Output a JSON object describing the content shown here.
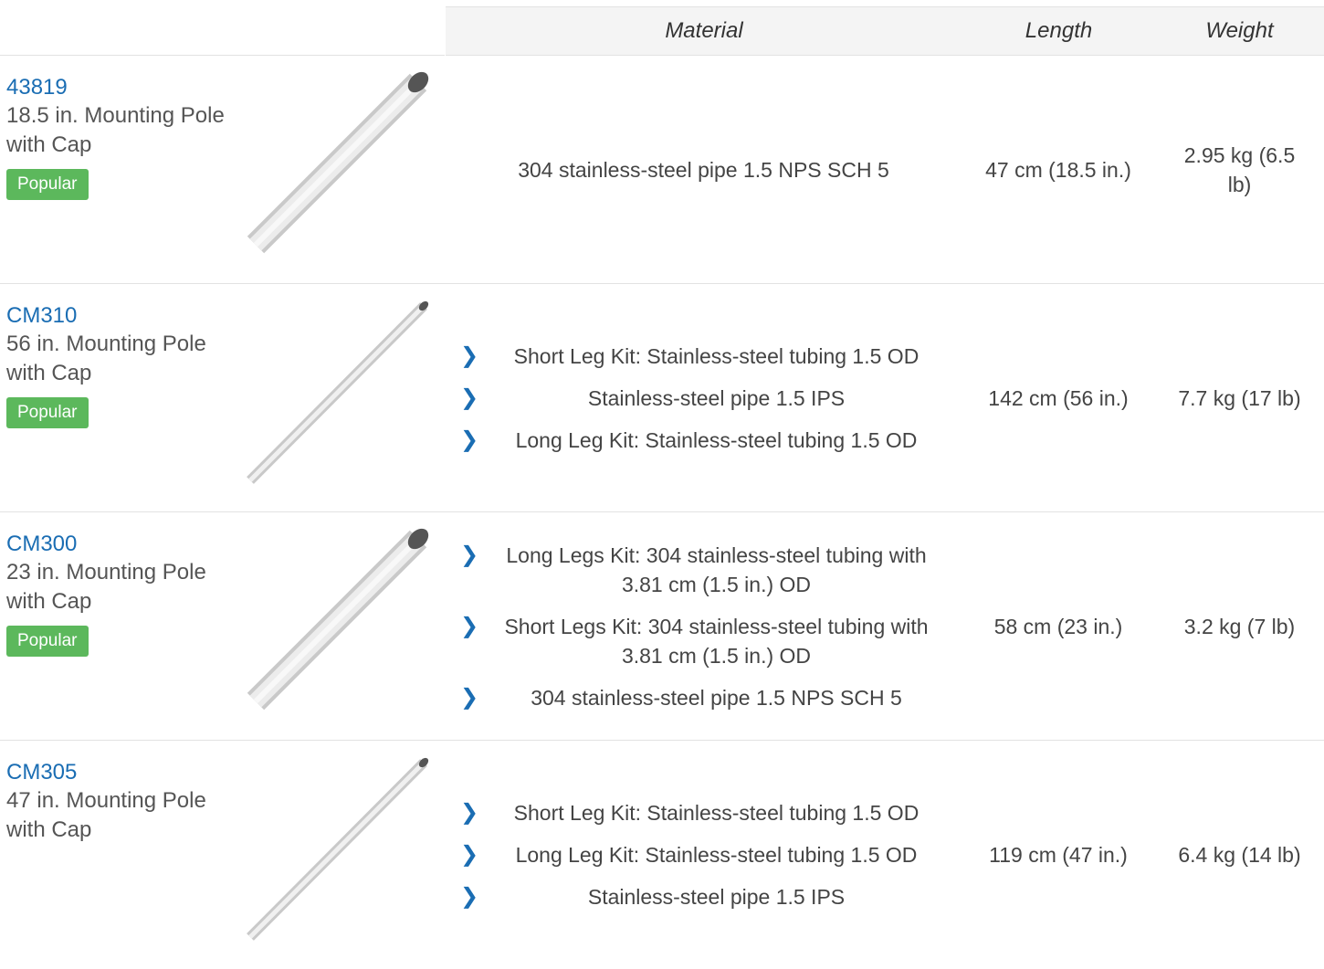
{
  "headers": {
    "material": "Material",
    "length": "Length",
    "weight": "Weight"
  },
  "rows": [
    {
      "code": "43819",
      "title": "18.5 in. Mounting Pole with Cap",
      "badge": "Popular",
      "materials": [
        "304 stainless-steel pipe 1.5 NPS SCH 5"
      ],
      "length": "47 cm (18.5 in.)",
      "weight": "2.95 kg (6.5 lb)"
    },
    {
      "code": "CM310",
      "title": "56 in. Mounting Pole with Cap",
      "badge": "Popular",
      "materials": [
        "Short Leg Kit: Stainless-steel tubing 1.5 OD",
        "Stainless-steel pipe 1.5 IPS",
        "Long Leg Kit: Stainless-steel tubing 1.5 OD"
      ],
      "length": "142 cm (56 in.)",
      "weight": "7.7 kg (17 lb)"
    },
    {
      "code": "CM300",
      "title": "23 in. Mounting Pole with Cap",
      "badge": "Popular",
      "materials": [
        "Long Legs Kit: 304 stainless-steel tubing with 3.81 cm (1.5 in.) OD",
        "Short Legs Kit: 304 stainless-steel tubing with 3.81 cm (1.5 in.) OD",
        "304 stainless-steel pipe 1.5 NPS SCH 5"
      ],
      "length": "58 cm (23 in.)",
      "weight": "3.2 kg (7 lb)"
    },
    {
      "code": "CM305",
      "title": "47 in. Mounting Pole with Cap",
      "badge": "",
      "materials": [
        "Short Leg Kit: Stainless-steel tubing 1.5 OD",
        "Long Leg Kit: Stainless-steel tubing 1.5 OD",
        "Stainless-steel pipe 1.5 IPS"
      ],
      "length": "119 cm (47 in.)",
      "weight": "6.4 kg (14 lb)"
    }
  ],
  "colors": {
    "link": "#1a6db3",
    "badge": "#5cb85c",
    "header_bg": "#f4f4f4",
    "border": "#e2e2e2"
  },
  "icons": {
    "bullet": "chevron-right-icon",
    "product_image": "mounting-pole-image"
  }
}
